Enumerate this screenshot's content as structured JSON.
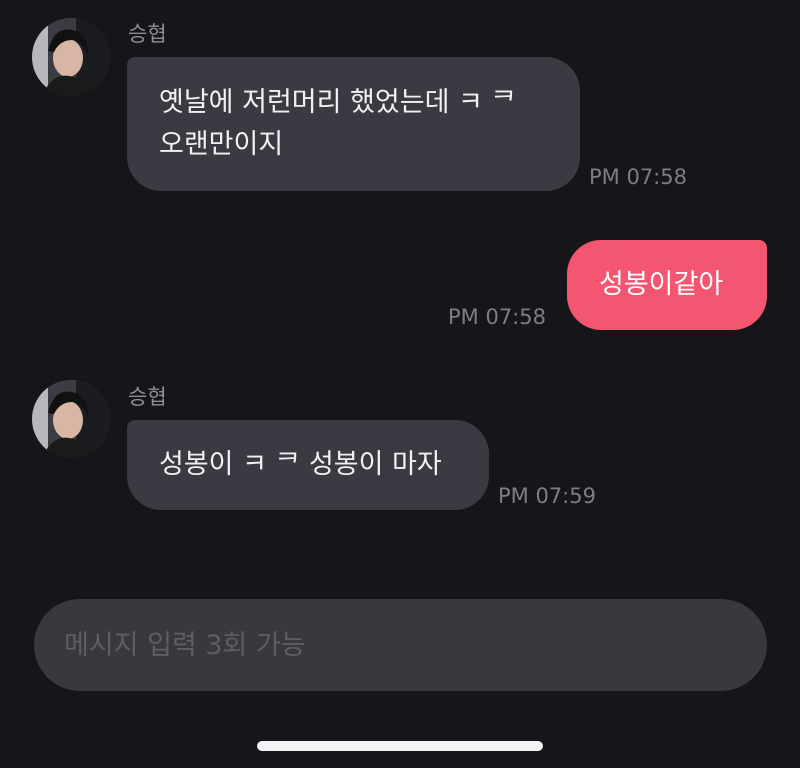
{
  "colors": {
    "background": "#151619",
    "received_bubble": "#3a3b42",
    "sent_bubble": "#f45672",
    "timestamp_text": "#7d7e85",
    "composer_background": "#38393f"
  },
  "messages": [
    {
      "direction": "received",
      "sender": "승협",
      "avatar_icon": "profile-photo",
      "lines": [
        "옛날에 저런머리 했었는데 ㅋ ᄏ",
        "오랜만이지"
      ],
      "time": "PM 07:58"
    },
    {
      "direction": "sent",
      "lines": [
        "성봉이같아"
      ],
      "time": "PM 07:58"
    },
    {
      "direction": "received",
      "sender": "승협",
      "avatar_icon": "profile-photo",
      "lines": [
        "성봉이 ㅋ ᄏ 성봉이 마자"
      ],
      "time": "PM 07:59"
    }
  ],
  "composer": {
    "placeholder": "메시지 입력 3회 가능"
  }
}
